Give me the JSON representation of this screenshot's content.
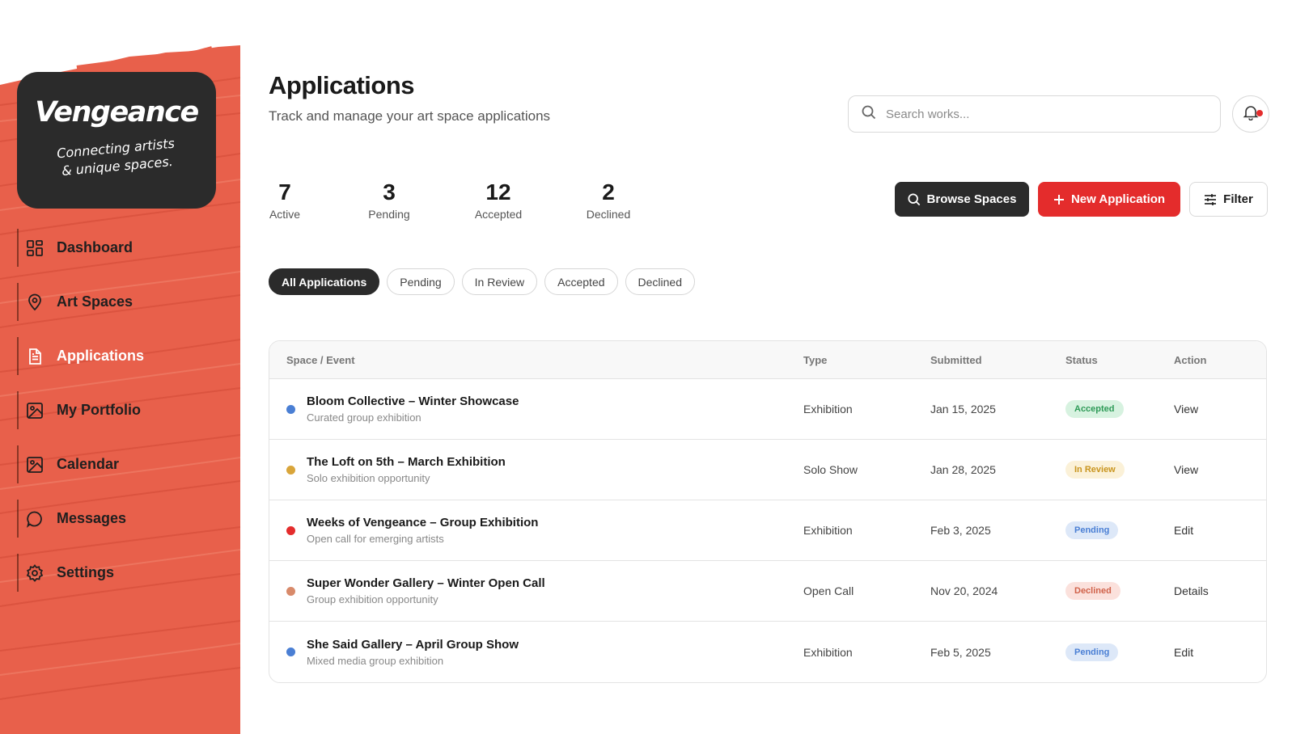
{
  "brand": {
    "name": "Vengeance",
    "tagline_line1": "Connecting artists",
    "tagline_line2": "& unique spaces."
  },
  "sidebar": {
    "items": [
      {
        "label": "Dashboard",
        "icon": "grid-icon"
      },
      {
        "label": "Art Spaces",
        "icon": "map-pin-icon"
      },
      {
        "label": "Applications",
        "icon": "document-icon",
        "active": true
      },
      {
        "label": "My Portfolio",
        "icon": "image-icon"
      },
      {
        "label": "Calendar",
        "icon": "image-icon"
      },
      {
        "label": "Messages",
        "icon": "chat-bubble-icon"
      },
      {
        "label": "Settings",
        "icon": "gear-icon"
      }
    ]
  },
  "header": {
    "title": "Applications",
    "subtitle": "Track and manage your art space applications",
    "search_placeholder": "Search works..."
  },
  "stats": [
    {
      "value": "7",
      "label": "Active"
    },
    {
      "value": "3",
      "label": "Pending"
    },
    {
      "value": "12",
      "label": "Accepted"
    },
    {
      "value": "2",
      "label": "Declined"
    }
  ],
  "actions": {
    "browse": "Browse Spaces",
    "new_application": "New Application",
    "filter": "Filter"
  },
  "filters": [
    "All Applications",
    "Pending",
    "In Review",
    "Accepted",
    "Declined"
  ],
  "table": {
    "columns": [
      "Space / Event",
      "Type",
      "Submitted",
      "Status",
      "Action"
    ],
    "rows": [
      {
        "title": "Bloom Collective – Winter Showcase",
        "subtitle": "Curated group exhibition",
        "type": "Exhibition",
        "submitted": "Jan 15, 2025",
        "status": "Accepted",
        "action": "View",
        "dot": "#4a7fd4"
      },
      {
        "title": "The Loft on 5th – March Exhibition",
        "subtitle": "Solo exhibition opportunity",
        "type": "Solo Show",
        "submitted": "Jan 28, 2025",
        "status": "In Review",
        "action": "View",
        "dot": "#d9a53a"
      },
      {
        "title": "Weeks of Vengeance – Group Exhibition",
        "subtitle": "Open call for emerging artists",
        "type": "Exhibition",
        "submitted": "Feb 3, 2025",
        "status": "Pending",
        "action": "Edit",
        "dot": "#e42c2c"
      },
      {
        "title": "Super Wonder Gallery – Winter Open Call",
        "subtitle": "Group exhibition opportunity",
        "type": "Open Call",
        "submitted": "Nov 20, 2024",
        "status": "Declined",
        "action": "Details",
        "dot": "#d88a6a"
      },
      {
        "title": "She Said Gallery – April Group Show",
        "subtitle": "Mixed media group exhibition",
        "type": "Exhibition",
        "submitted": "Feb 5, 2025",
        "status": "Pending",
        "action": "Edit",
        "dot": "#4a7fd4"
      }
    ]
  },
  "colors": {
    "accent_red": "#e42c2c",
    "paint": "#e8604b",
    "dark": "#2b2b2b",
    "status": {
      "Accepted": {
        "bg": "#d7f2e0",
        "fg": "#2e9a57"
      },
      "In Review": {
        "bg": "#fbf1d8",
        "fg": "#c9951f"
      },
      "Pending": {
        "bg": "#dde8f8",
        "fg": "#4a7fd4"
      },
      "Declined": {
        "bg": "#fbe1dc",
        "fg": "#d0624a"
      }
    }
  }
}
